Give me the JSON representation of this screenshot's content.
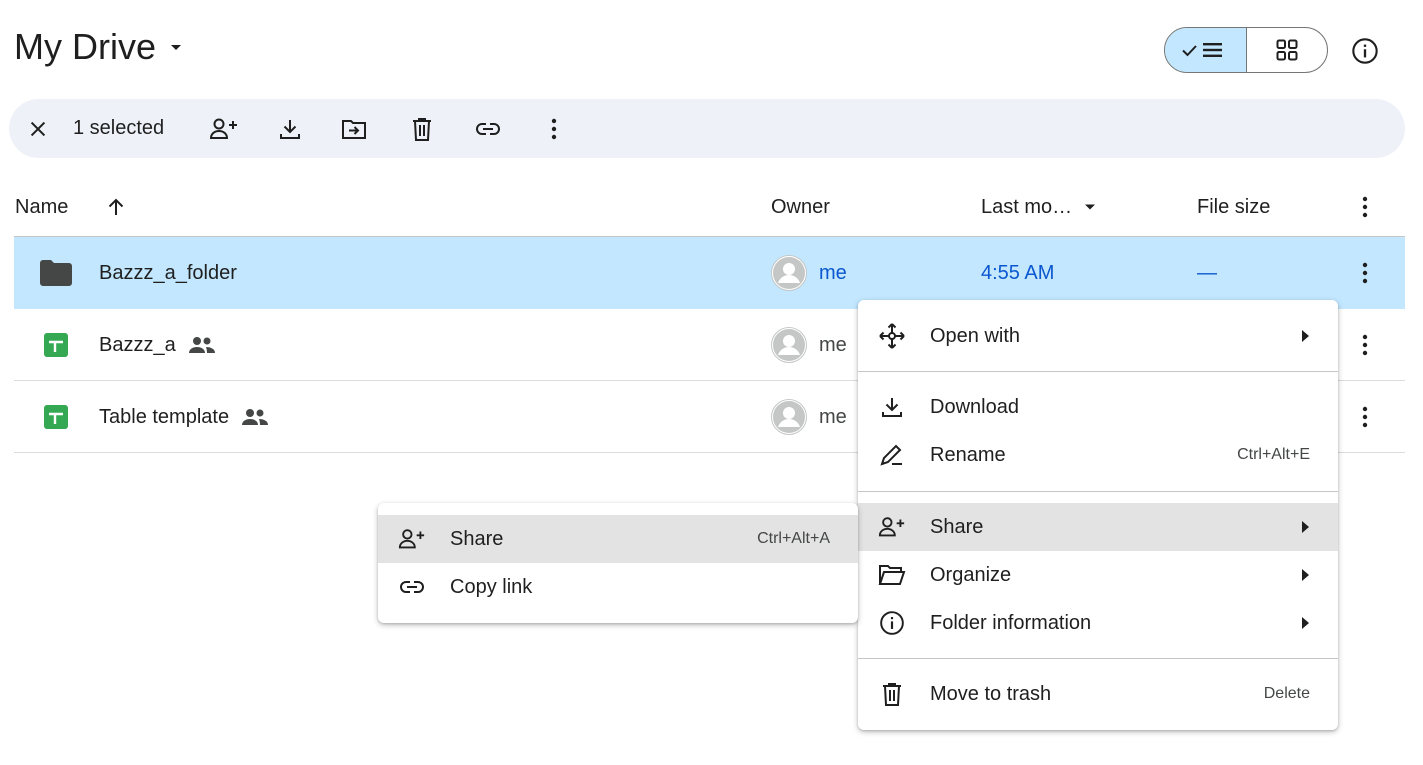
{
  "header": {
    "title": "My Drive"
  },
  "selection_bar": {
    "count_label": "1 selected"
  },
  "table": {
    "columns": {
      "name": "Name",
      "owner": "Owner",
      "modified": "Last mo…",
      "size": "File size"
    },
    "rows": [
      {
        "name": "Bazzz_a_folder",
        "type": "folder",
        "owner": "me",
        "modified": "4:55 AM",
        "size": "—",
        "shared": false,
        "selected": true
      },
      {
        "name": "Bazzz_a",
        "type": "sheet",
        "owner": "me",
        "modified": "",
        "size": "",
        "shared": true,
        "selected": false
      },
      {
        "name": "Table template",
        "type": "sheet",
        "owner": "me",
        "modified": "",
        "size": "",
        "shared": true,
        "selected": false
      }
    ]
  },
  "context_menu": {
    "items": [
      {
        "icon": "open-with-icon",
        "label": "Open with",
        "shortcut": "",
        "submenu": true
      },
      {
        "icon": "download-icon",
        "label": "Download",
        "shortcut": "",
        "submenu": false
      },
      {
        "icon": "rename-icon",
        "label": "Rename",
        "shortcut": "Ctrl+Alt+E",
        "submenu": false
      },
      {
        "icon": "share-icon",
        "label": "Share",
        "shortcut": "",
        "submenu": true,
        "highlighted": true
      },
      {
        "icon": "organize-icon",
        "label": "Organize",
        "shortcut": "",
        "submenu": true
      },
      {
        "icon": "info-icon",
        "label": "Folder information",
        "shortcut": "",
        "submenu": true
      },
      {
        "icon": "trash-icon",
        "label": "Move to trash",
        "shortcut": "Delete",
        "submenu": false
      }
    ]
  },
  "share_submenu": {
    "items": [
      {
        "icon": "share-icon",
        "label": "Share",
        "shortcut": "Ctrl+Alt+A",
        "highlighted": true
      },
      {
        "icon": "link-icon",
        "label": "Copy link",
        "shortcut": ""
      }
    ]
  },
  "colors": {
    "selected_row": "#c2e7ff",
    "toolbar_bg": "#eef2f8",
    "sheets_green": "#34a853",
    "menu_highlight": "#e3e3e3",
    "text": "#1f1f1f"
  }
}
